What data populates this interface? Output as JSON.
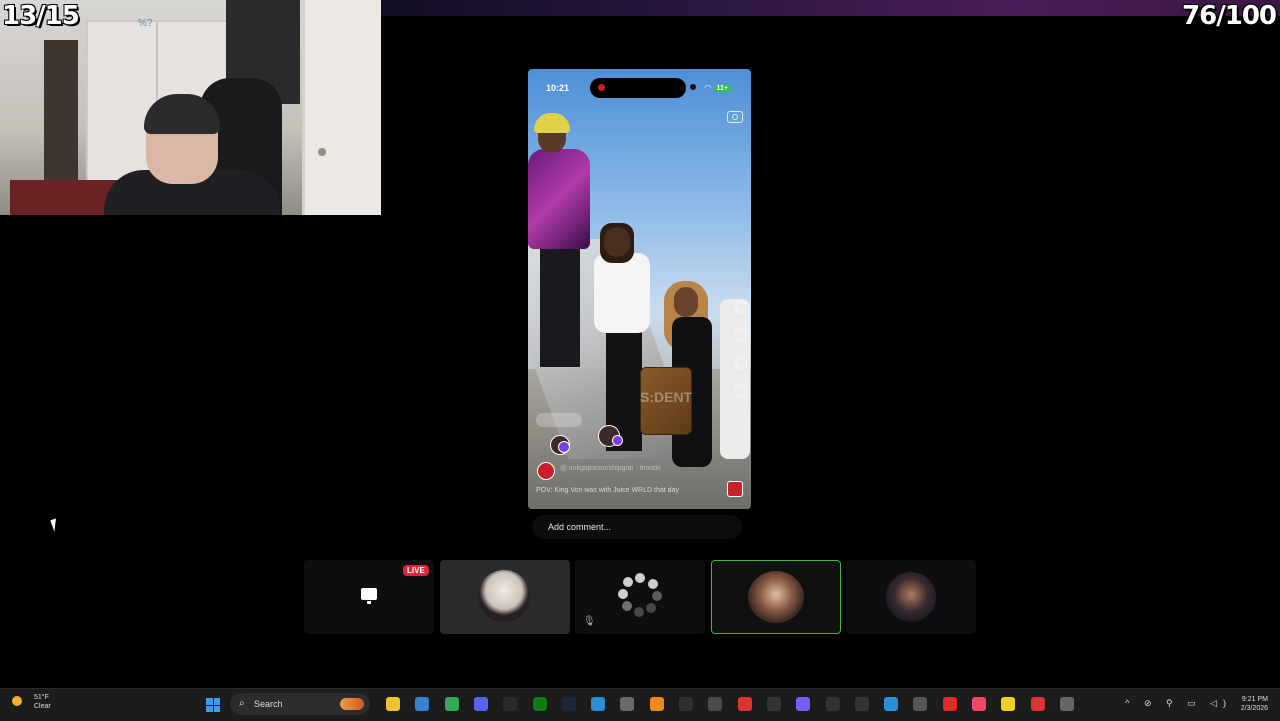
{
  "overlay": {
    "left_counter": "13/15",
    "right_counter": "76/100"
  },
  "webcam": {
    "tag": "%?"
  },
  "phone": {
    "status_time": "10:21",
    "battery": "11+",
    "watermark": "S:DENT",
    "caption_user": "@ tinkgsponsorshipgrai · 8mode",
    "caption_text": "POV: King Von was with Juice WRLD that day"
  },
  "comment_bar": {
    "placeholder": "Add comment..."
  },
  "participants": {
    "live_badge": "LIVE",
    "muted_icon": "🎙"
  },
  "taskbar": {
    "weather_temp": "51°F",
    "weather_desc": "Clear",
    "search_label": "Search",
    "search_icon": "⌕",
    "tray_icons": "^ ⊘ ⚲ ▭ ◁)",
    "time": "9:21 PM",
    "date": "2/3/2026",
    "apps": [
      {
        "name": "file-explorer-icon",
        "color": "#f2c230"
      },
      {
        "name": "calendar-app-icon",
        "color": "#3a7fd0"
      },
      {
        "name": "chrome-icon",
        "color": "#35a853"
      },
      {
        "name": "discord-icon",
        "color": "#5865f2"
      },
      {
        "name": "epic-games-icon",
        "color": "#2a2a2a"
      },
      {
        "name": "xbox-icon",
        "color": "#107c10"
      },
      {
        "name": "steam-icon",
        "color": "#1b2838"
      },
      {
        "name": "edge-icon",
        "color": "#2b8fd6"
      },
      {
        "name": "minecraft-icon",
        "color": "#6b6b6b"
      },
      {
        "name": "vlc-icon",
        "color": "#f08a1a"
      },
      {
        "name": "obs-icon",
        "color": "#303030"
      },
      {
        "name": "settings-icon",
        "color": "#4a4a4a"
      },
      {
        "name": "record-app-icon",
        "color": "#d33"
      },
      {
        "name": "capcut-icon",
        "color": "#333"
      },
      {
        "name": "grid-app-icon",
        "color": "#7a5cf0"
      },
      {
        "name": "ok-app-icon",
        "color": "#333"
      },
      {
        "name": "pen-app-icon",
        "color": "#333"
      },
      {
        "name": "cloud-app-icon",
        "color": "#2b8fd6"
      },
      {
        "name": "game-launcher-icon",
        "color": "#555"
      },
      {
        "name": "youtube-icon",
        "color": "#e02a2a"
      },
      {
        "name": "music-icon",
        "color": "#f0466a"
      },
      {
        "name": "emoji-app-icon",
        "color": "#f0d020"
      },
      {
        "name": "map-pin-icon",
        "color": "#d33"
      },
      {
        "name": "gear-icon",
        "color": "#666"
      }
    ]
  }
}
